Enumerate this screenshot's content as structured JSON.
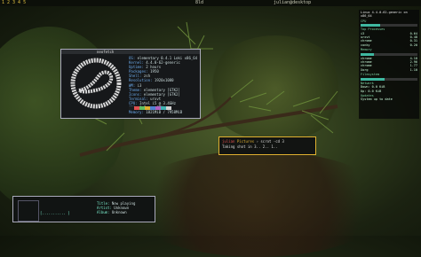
{
  "topbar": {
    "left": "1 2 3 4 5",
    "mid": "8ld",
    "right": "julian@desktop"
  },
  "neofetch": {
    "title": "neofetch",
    "info": [
      {
        "k": "OS:",
        "v": "elementary 0.4.1 Loki x86_64"
      },
      {
        "k": "Kernel:",
        "v": "4.4.0-62-generic"
      },
      {
        "k": "Uptime:",
        "v": "2 hours"
      },
      {
        "k": "Packages:",
        "v": "1950"
      },
      {
        "k": "Shell:",
        "v": "zsh"
      },
      {
        "k": "Resolution:",
        "v": "1920x1080"
      },
      {
        "k": "WM:",
        "v": "i3"
      },
      {
        "k": "Theme:",
        "v": "elementary [GTK2]"
      },
      {
        "k": "Icons:",
        "v": "elementary [GTK2]"
      },
      {
        "k": "Terminal:",
        "v": "urxvt"
      },
      {
        "k": "CPU:",
        "v": "Intel i5 @ 3.4GHz"
      },
      {
        "k": "GPU:",
        "v": "GeForce GTX"
      },
      {
        "k": "Memory:",
        "v": "1821MiB / 7958MiB"
      }
    ],
    "palette": [
      "#1b1d1e",
      "#e05050",
      "#60c060",
      "#e0b030",
      "#5080d0",
      "#b060c0",
      "#40b0b0",
      "#d0d0d0"
    ]
  },
  "sysmon": {
    "header": "Linux 4.4.0-62-generic on x86_64",
    "cpu_label": "CPU",
    "cpu_level": 0.35,
    "cpu_processes_label": "Top Processes",
    "cpu_procs": [
      {
        "name": "i3",
        "val": "0.64"
      },
      {
        "name": "urxvt",
        "val": "0.48"
      },
      {
        "name": "chrome",
        "val": "0.31"
      },
      {
        "name": "conky",
        "val": "0.20"
      }
    ],
    "mem_label": "Memory",
    "mem_level": 0.23,
    "mem_procs": [
      {
        "name": "chrome",
        "val": "4.18"
      },
      {
        "name": "chrome",
        "val": "2.96"
      },
      {
        "name": "chrome",
        "val": "1.77"
      },
      {
        "name": "Xorg",
        "val": "1.10"
      }
    ],
    "disk_label": "Filesystem",
    "disk_level": 0.42,
    "net_label": "Network",
    "net_lines": [
      "Down: 0.0 KiB",
      "Up: 0.0 KiB"
    ],
    "footer": [
      "Updates",
      "System up to date"
    ]
  },
  "scrot": {
    "user": "julian",
    "dir": "Pictures",
    "cmd": "scrot -cd 3",
    "output": "Taking shot in 3.. 2.. 1.."
  },
  "music": {
    "progress": "[........... ]",
    "meta": [
      {
        "k": "Title:",
        "v": "Now playing"
      },
      {
        "k": "Artist:",
        "v": "Unknown"
      },
      {
        "k": "Album:",
        "v": "Unknown"
      }
    ]
  }
}
